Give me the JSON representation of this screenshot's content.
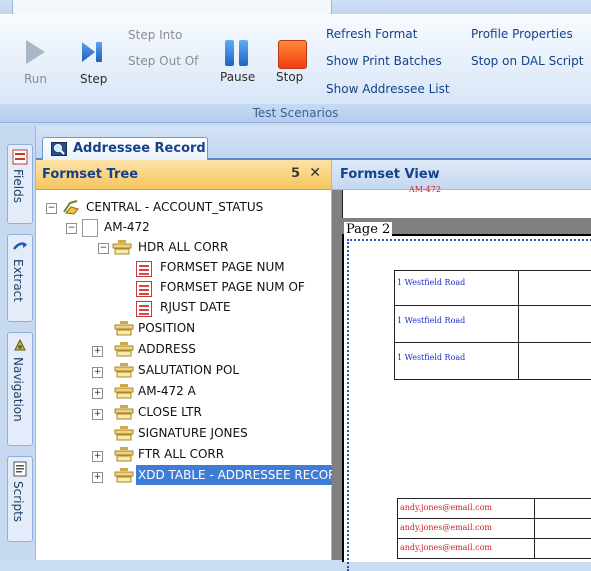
{
  "ribbon": {
    "run_label": "Run",
    "step_label": "Step",
    "step_into_label": "Step Into",
    "step_out_label": "Step Out Of",
    "pause_label": "Pause",
    "stop_label": "Stop",
    "refresh_format": "Refresh Format",
    "show_print_batches": "Show Print Batches",
    "show_addressee_list": "Show Addressee List",
    "profile_properties": "Profile Properties",
    "stop_on_dal_script": "Stop on DAL Script",
    "group_label": "Test Scenarios"
  },
  "rail": {
    "tabs": [
      "Fields",
      "Extract",
      "Navigation",
      "Scripts"
    ]
  },
  "doc_tab": {
    "title": "Addressee Record"
  },
  "tree": {
    "title": "Formset Tree",
    "pin_glyph": "฿",
    "close_glyph": "✕",
    "nodes": [
      "CENTRAL - ACCOUNT_STATUS",
      "AM-472",
      "HDR ALL CORR",
      "FORMSET PAGE NUM",
      "FORMSET PAGE NUM OF",
      "RJUST DATE",
      "POSITION",
      "ADDRESS",
      "SALUTATION POL",
      "AM-472 A",
      "CLOSE LTR",
      "SIGNATURE JONES",
      "FTR ALL CORR",
      "XDD TABLE - ADDRESSEE RECORD"
    ]
  },
  "view": {
    "title": "Formset View",
    "top_fragment": "AM-472",
    "page_label": "Page 2",
    "address_cells": [
      "1 Westfield Road",
      "1 Westfield Road",
      "1 Westfield Road"
    ],
    "email_cells": [
      "andy.jones@email.com",
      "andy.jones@email.com",
      "andy.jones@email.com"
    ]
  },
  "colors": {
    "ribbon_link": "#15428b",
    "selection": "#3f7cd6",
    "tree_header": "#f6c55f",
    "stop_icon": "#ef3d10",
    "pause_icon": "#2c7fd8"
  }
}
